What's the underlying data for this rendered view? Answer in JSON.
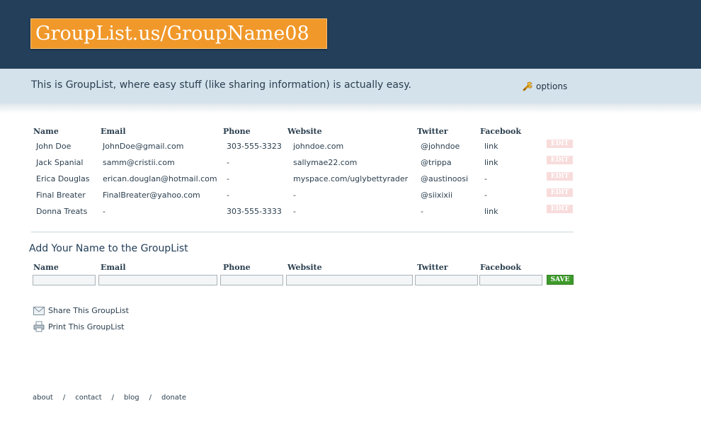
{
  "header": {
    "logo_text": "GroupList.us/GroupName08"
  },
  "tagline": {
    "text": "This is GroupList, where easy stuff (like sharing information) is actually easy.",
    "options_label": "options"
  },
  "columns": [
    "Name",
    "Email",
    "Phone",
    "Website",
    "Twitter",
    "Facebook"
  ],
  "rows": [
    [
      "John Doe",
      "JohnDoe@gmail.com",
      "303-555-3323",
      "johndoe.com",
      "@johndoe",
      "link"
    ],
    [
      "Jack Spanial",
      "samm@cristii.com",
      "-",
      "sallymae22.com",
      "@trippa",
      "link"
    ],
    [
      "Erica Douglas",
      "erican.douglan@hotmail.com",
      "-",
      "myspace.com/uglybettyrader",
      "@austinoosi",
      "-"
    ],
    [
      "Final Breater",
      "FinalBreater@yahoo.com",
      "-",
      "-",
      "@siixixii",
      "-"
    ],
    [
      "Donna Treats",
      "-",
      "303-555-3333",
      "-",
      "-",
      "link"
    ]
  ],
  "edit_label": "EDIT",
  "add_section": {
    "title": "Add Your Name to the GroupList",
    "columns": [
      "Name",
      "Email",
      "Phone",
      "Website",
      "Twitter",
      "Facebook"
    ],
    "values": [
      "",
      "",
      "",
      "",
      "",
      ""
    ],
    "save_label": "SAVE"
  },
  "actions": {
    "share": "Share This GroupList",
    "print": "Print This GroupList"
  },
  "footer": {
    "links": [
      "about",
      "contact",
      "blog",
      "donate"
    ],
    "separator": "/"
  },
  "colors": {
    "header_bg": "#233f5a",
    "logo_bg": "#f0982a",
    "tagline_bg": "#d4e2ec",
    "edit_bg": "#f8dcdc",
    "save_bg": "#3e9a2b"
  }
}
